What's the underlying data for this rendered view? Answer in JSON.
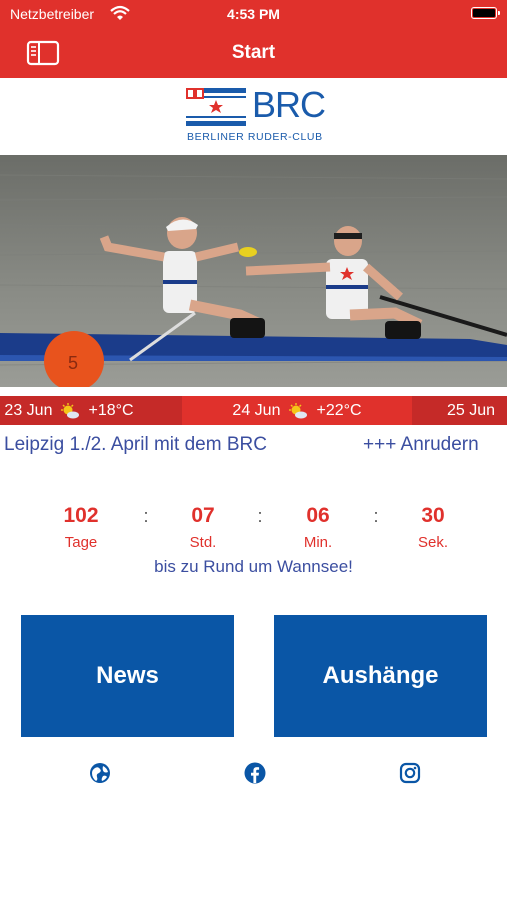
{
  "status_bar": {
    "carrier": "Netzbetreiber",
    "time": "4:53 PM"
  },
  "nav": {
    "title": "Start"
  },
  "logo": {
    "name": "BRC",
    "subtitle": "BERLINER RUDER-CLUB"
  },
  "hero": {
    "buoy_number": "5"
  },
  "weather": [
    {
      "date": "23 Jun",
      "temp": "+18°C",
      "icon": "sun-cloud-icon"
    },
    {
      "date": "24 Jun",
      "temp": "+22°C",
      "icon": "sun-cloud-icon"
    },
    {
      "date": "25 Jun",
      "temp": "",
      "icon": ""
    }
  ],
  "ticker": {
    "item_1": "Leipzig 1./2. April mit dem BRC",
    "item_2": "+++ Anrudern"
  },
  "countdown": {
    "days": "102",
    "days_label": "Tage",
    "hours": "07",
    "hours_label": "Std.",
    "minutes": "06",
    "minutes_label": "Min.",
    "seconds": "30",
    "seconds_label": "Sek.",
    "separator": ":",
    "caption": "bis zu Rund um Wannsee!"
  },
  "tiles": {
    "news": "News",
    "notices": "Aushänge"
  },
  "social": [
    "globe-icon",
    "facebook-icon",
    "instagram-icon"
  ],
  "colors": {
    "brand_red": "#e0312c",
    "dark_red": "#c52a28",
    "brand_blue": "#0a56a6",
    "text_blue": "#3b4ea0"
  }
}
